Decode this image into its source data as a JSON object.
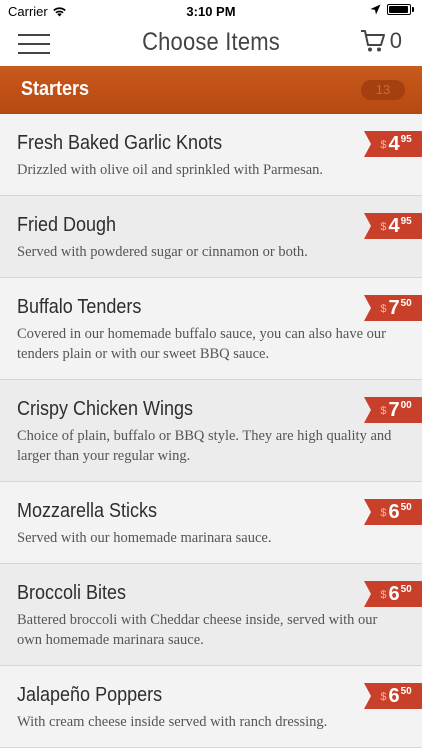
{
  "status_bar": {
    "carrier": "Carrier",
    "time": "3:10 PM",
    "icons": [
      "wifi-icon",
      "location-icon",
      "battery-icon"
    ]
  },
  "nav": {
    "title": "Choose Items",
    "cart_count": "0",
    "icons": [
      "hamburger-menu-icon",
      "cart-icon"
    ]
  },
  "category": {
    "title": "Starters",
    "count": "13"
  },
  "colors": {
    "header_orange": "#c24f17",
    "price_tag_red": "#c9402a"
  },
  "items": [
    {
      "name": "Fresh Baked Garlic Knots",
      "description": "Drizzled with olive oil and sprinkled with Parmesan.",
      "currency": "$",
      "price_whole": "4",
      "price_cents": "95"
    },
    {
      "name": "Fried Dough",
      "description": "Served with powdered sugar or cinnamon or both.",
      "currency": "$",
      "price_whole": "4",
      "price_cents": "95"
    },
    {
      "name": "Buffalo Tenders",
      "description": "Covered in our homemade buffalo sauce,  you can also have our tenders plain or with our sweet BBQ sauce.",
      "currency": "$",
      "price_whole": "7",
      "price_cents": "50"
    },
    {
      "name": "Crispy Chicken Wings",
      "description": "Choice of plain,  buffalo or BBQ style.  They are high quality and larger than your regular wing.",
      "currency": "$",
      "price_whole": "7",
      "price_cents": "00"
    },
    {
      "name": "Mozzarella Sticks",
      "description": "Served with our homemade marinara sauce.",
      "currency": "$",
      "price_whole": "6",
      "price_cents": "50"
    },
    {
      "name": "Broccoli Bites",
      "description": "Battered broccoli with Cheddar cheese inside,  served with our own homemade marinara sauce.",
      "currency": "$",
      "price_whole": "6",
      "price_cents": "50"
    },
    {
      "name": "Jalapeño Poppers",
      "description": "With cream cheese inside served with ranch dressing.",
      "currency": "$",
      "price_whole": "6",
      "price_cents": "50"
    }
  ]
}
